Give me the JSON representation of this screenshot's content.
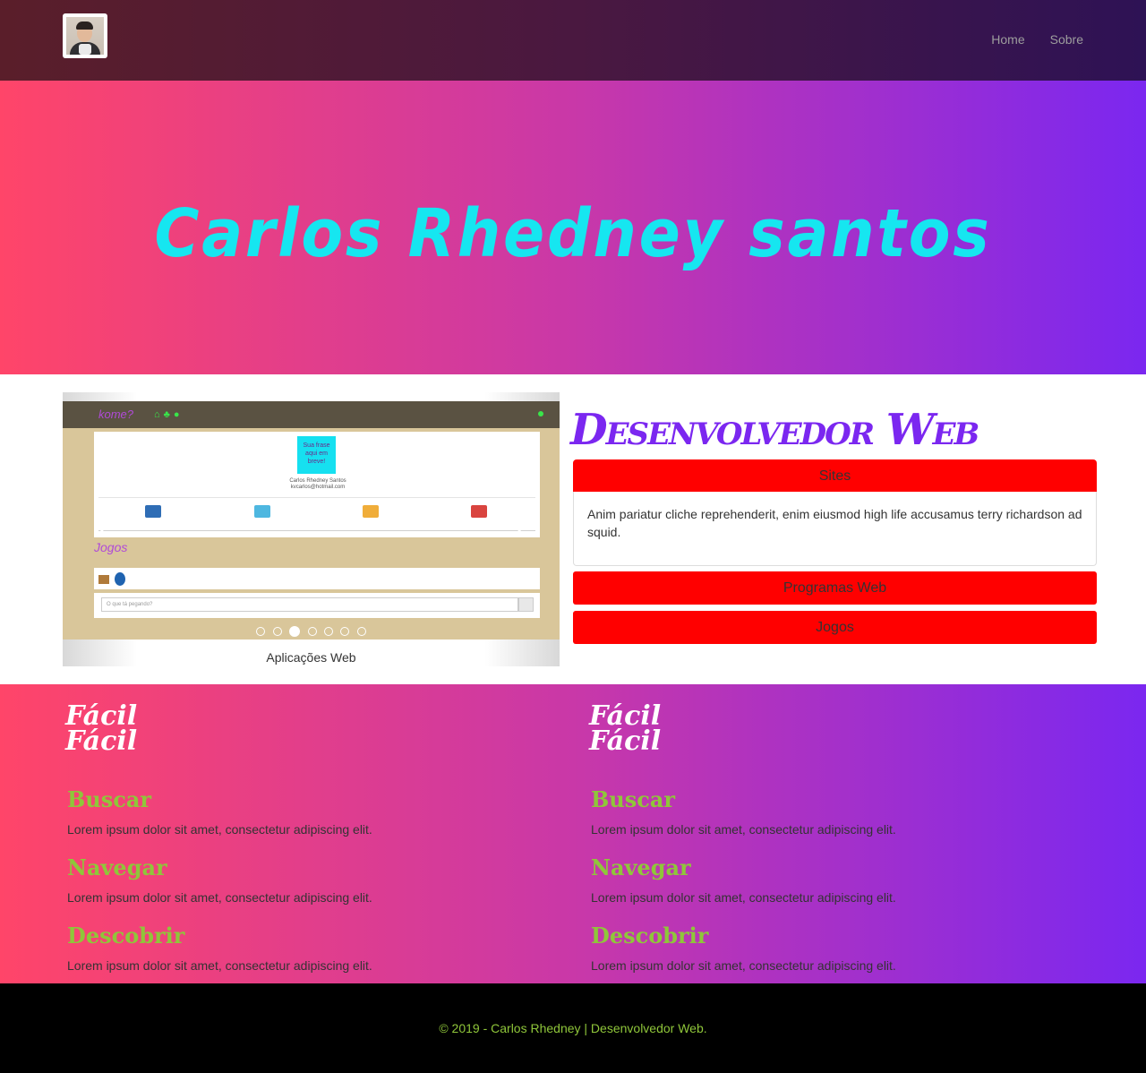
{
  "nav": {
    "links": [
      "Home",
      "Sobre"
    ]
  },
  "hero": {
    "title": "Carlos Rhedney santos"
  },
  "carousel": {
    "caption": "Aplicações Web",
    "slide_count": 7,
    "active_slide": 3,
    "screenshot": {
      "name_line": "Carlos Rhedney Santos",
      "email_line": "kvcarlos@hotmail.com",
      "note_text": "Sua frase aqui em breve!",
      "games_label": "Jogos",
      "input_placeholder": "O que tá pegando?",
      "counts": [
        "1",
        "1",
        "1",
        "1"
      ]
    }
  },
  "dev": {
    "title": "Desenvolvedor Web",
    "accordion": [
      {
        "label": "Sites",
        "body": "Anim pariatur cliche reprehenderit, enim eiusmod high life accusamus terry richardson ad squid."
      },
      {
        "label": "Programas Web"
      },
      {
        "label": "Jogos"
      }
    ]
  },
  "features": {
    "columns": [
      {
        "logo": "Fácil Fácil",
        "items": [
          {
            "title": "Buscar",
            "text": "Lorem ipsum dolor sit amet, consectetur adipiscing elit."
          },
          {
            "title": "Navegar",
            "text": "Lorem ipsum dolor sit amet, consectetur adipiscing elit."
          },
          {
            "title": "Descobrir",
            "text": "Lorem ipsum dolor sit amet, consectetur adipiscing elit."
          }
        ]
      },
      {
        "logo": "Fácil Fácil",
        "items": [
          {
            "title": "Buscar",
            "text": "Lorem ipsum dolor sit amet, consectetur adipiscing elit."
          },
          {
            "title": "Navegar",
            "text": "Lorem ipsum dolor sit amet, consectetur adipiscing elit."
          },
          {
            "title": "Descobrir",
            "text": "Lorem ipsum dolor sit amet, consectetur adipiscing elit."
          }
        ]
      }
    ]
  },
  "footer": {
    "text": "© 2019 - Carlos Rhedney | Desenvolvedor Web."
  },
  "colors": {
    "hero_title": "#16e6f0",
    "dev_title": "#7b27f0",
    "accordion_header": "#ff0000",
    "feature_title": "#8fc63a",
    "footer_text": "#8fc63a",
    "gradient_start": "#ff4569",
    "gradient_end": "#7b27f0"
  }
}
